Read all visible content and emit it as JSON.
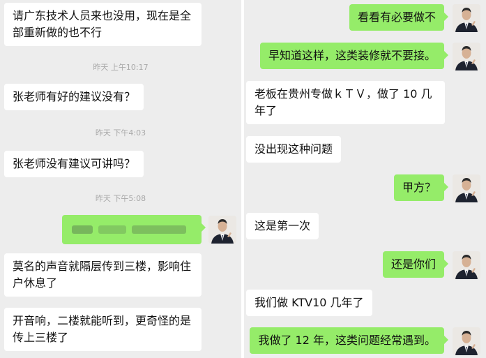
{
  "left_pane": {
    "messages": [
      {
        "text": "请广东技术人员来也没用，现在是全部重新做的也不行"
      },
      {
        "text": "张老师有好的建议没有？"
      },
      {
        "text": "张老师没有建议可讲吗？"
      },
      {
        "text": "莫名的声音就隔层传到三楼，影响住户休息了"
      },
      {
        "text": "开音响，二楼就能听到，更奇怪的是传上三楼了"
      }
    ],
    "timestamps": [
      "昨天 上午10:17",
      "昨天 下午4:03",
      "昨天 下午5:08"
    ]
  },
  "right_pane": {
    "messages": [
      {
        "text": "看看有必要做不"
      },
      {
        "text": "早知道这样，这类装修就不要接。"
      },
      {
        "text": "老板在贵州专做ｋＴＶ，做了 10 几年了"
      },
      {
        "text": "没出现这种问题"
      },
      {
        "text": "甲方？"
      },
      {
        "text": "这是第一次"
      },
      {
        "text": "还是你们"
      },
      {
        "text": "我们做 KTV10 几年了"
      },
      {
        "text": "我做了 12 年，这类问题经常遇到。"
      }
    ]
  },
  "colors": {
    "chat_bg": "#ededed",
    "bubble_self": "#95ec69",
    "bubble_other": "#ffffff",
    "timestamp": "#a8a8a8"
  }
}
